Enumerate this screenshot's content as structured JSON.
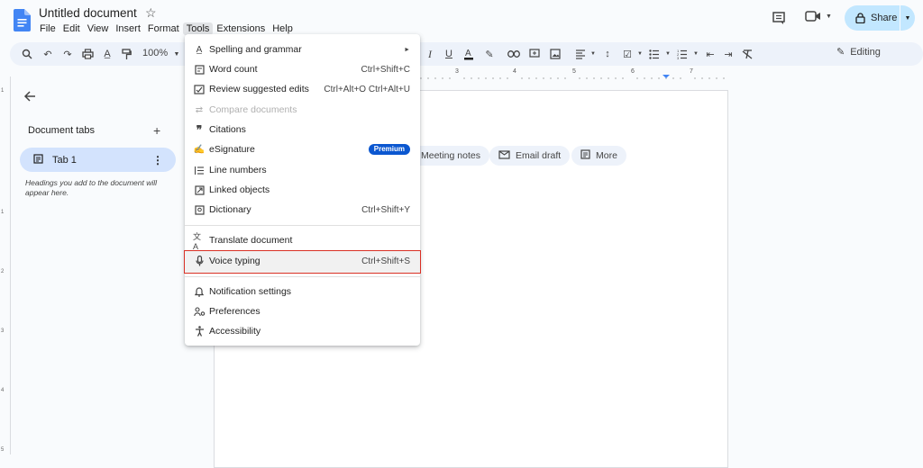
{
  "app": {
    "doc_title": "Untitled document",
    "menus": [
      "File",
      "Edit",
      "View",
      "Insert",
      "Format",
      "Tools",
      "Extensions",
      "Help"
    ],
    "active_menu": "Tools",
    "share_label": "Share",
    "accent_color": "#0b57d0"
  },
  "toolbar": {
    "zoom": "100%",
    "editing_label": "Editing",
    "icons": [
      "search-icon",
      "undo-icon",
      "redo-icon",
      "print-icon",
      "spellcheck-icon",
      "paint-format-icon",
      "italic-icon",
      "underline-icon",
      "text-color-icon",
      "highlight-icon",
      "link-icon",
      "comment-add-icon",
      "image-icon",
      "align-icon",
      "line-spacing-icon",
      "checklist-icon",
      "bullet-list-icon",
      "numbered-list-icon",
      "decrease-indent-icon",
      "increase-indent-icon",
      "clear-format-icon"
    ]
  },
  "sidebar": {
    "title": "Document tabs",
    "tab_label": "Tab 1",
    "hint": "Headings you add to the document will appear here."
  },
  "chips": [
    "Meeting notes",
    "Email draft",
    "More"
  ],
  "ruler": [
    "3",
    "4",
    "5",
    "6",
    "7"
  ],
  "vruler": [
    "1",
    "1",
    "2",
    "3",
    "4",
    "5"
  ],
  "tools_menu": {
    "items": [
      {
        "label": "Spelling and grammar",
        "shortcut": "",
        "icon": "spellcheck-icon",
        "submenu": true
      },
      {
        "label": "Word count",
        "shortcut": "Ctrl+Shift+C",
        "icon": "word-count-icon"
      },
      {
        "label": "Review suggested edits",
        "shortcut": "Ctrl+Alt+O Ctrl+Alt+U",
        "icon": "review-edits-icon"
      },
      {
        "label": "Compare documents",
        "shortcut": "",
        "icon": "compare-icon",
        "disabled": true
      },
      {
        "label": "Citations",
        "shortcut": "",
        "icon": "citations-icon"
      },
      {
        "label": "eSignature",
        "shortcut": "",
        "icon": "esignature-icon",
        "badge": "Premium"
      },
      {
        "label": "Line numbers",
        "shortcut": "",
        "icon": "line-numbers-icon"
      },
      {
        "label": "Linked objects",
        "shortcut": "",
        "icon": "linked-objects-icon"
      },
      {
        "label": "Dictionary",
        "shortcut": "Ctrl+Shift+Y",
        "icon": "dictionary-icon"
      },
      {
        "label": "Translate document",
        "shortcut": "",
        "icon": "translate-icon"
      },
      {
        "label": "Voice typing",
        "shortcut": "Ctrl+Shift+S",
        "icon": "microphone-icon"
      },
      {
        "label": "Notification settings",
        "shortcut": "",
        "icon": "bell-icon"
      },
      {
        "label": "Preferences",
        "shortcut": "",
        "icon": "preferences-icon"
      },
      {
        "label": "Accessibility",
        "shortcut": "",
        "icon": "accessibility-icon"
      }
    ]
  }
}
